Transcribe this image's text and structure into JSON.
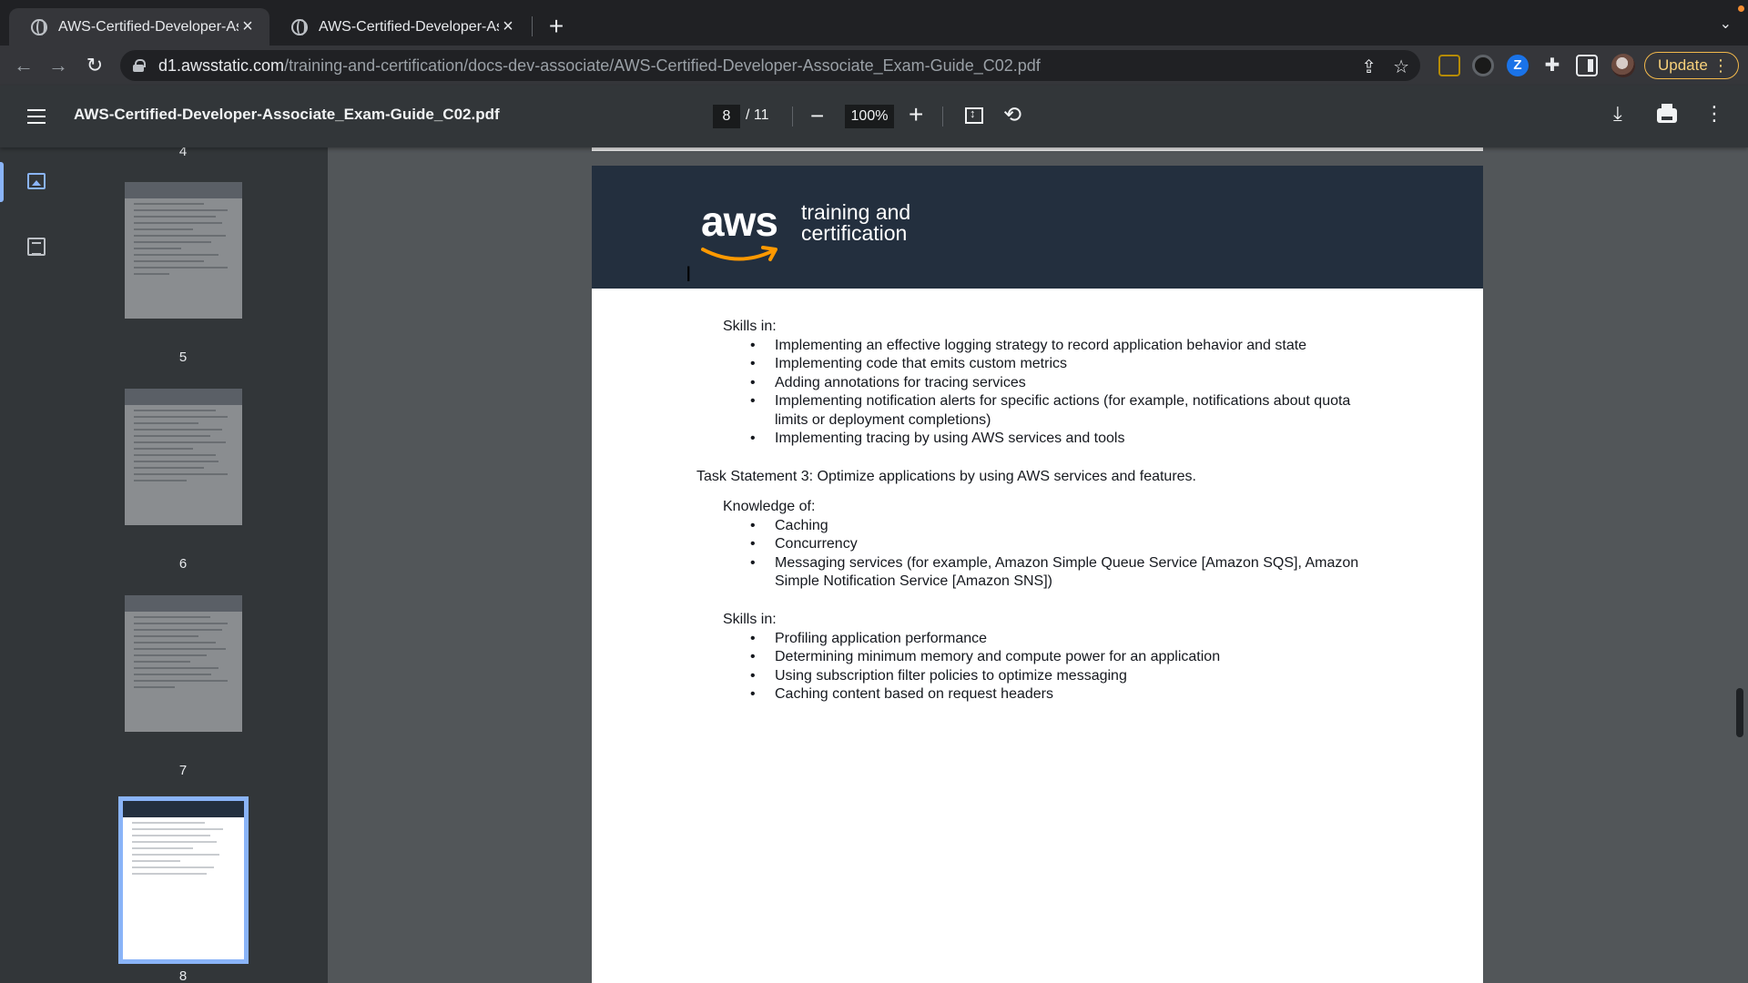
{
  "browser": {
    "tabs": [
      {
        "title": "AWS-Certified-Developer-Associate_Exam-Guide_C02.pdf",
        "active": true
      },
      {
        "title": "AWS-Certified-Developer-Associate_Exam-Guide_C02.pdf",
        "active": false
      }
    ],
    "url_host": "d1.awsstatic.com",
    "url_path": "/training-and-certification/docs-dev-associate/AWS-Certified-Developer-Associate_Exam-Guide_C02.pdf",
    "update_label": "Update",
    "extension_z_label": "Z"
  },
  "pdf_toolbar": {
    "title": "AWS-Certified-Developer-Associate_Exam-Guide_C02.pdf",
    "current_page": "8",
    "total_pages": "/ 11",
    "zoom": "100%"
  },
  "sidebar": {
    "pages": [
      {
        "label": "4"
      },
      {
        "label": "5"
      },
      {
        "label": "6"
      },
      {
        "label": "7"
      },
      {
        "label": "8",
        "current": true
      }
    ]
  },
  "document": {
    "logo_text": "aws",
    "tagline_line1": "training and",
    "tagline_line2": "certification",
    "skills1_heading": "Skills in:",
    "skills1_items": [
      "Implementing an effective logging strategy to record application behavior and state",
      "Implementing code that emits custom metrics",
      "Adding annotations for tracing services",
      "Implementing notification alerts for specific actions (for example, notifications about quota limits or deployment completions)",
      "Implementing tracing by using AWS services and tools"
    ],
    "task_statement": "Task Statement 3: Optimize applications by using AWS services and features.",
    "knowledge_heading": "Knowledge of:",
    "knowledge_items": [
      "Caching",
      "Concurrency",
      "Messaging services (for example, Amazon Simple Queue Service [Amazon SQS], Amazon Simple Notification Service [Amazon SNS])"
    ],
    "skills2_heading": "Skills in:",
    "skills2_items": [
      "Profiling application performance",
      "Determining minimum memory and compute power for an application",
      "Using subscription filter policies to optimize messaging",
      "Caching content based on request headers"
    ]
  },
  "colors": {
    "aws_orange": "#ff9900",
    "header_navy": "#232f3e",
    "accent_blue": "#8ab4f8"
  }
}
